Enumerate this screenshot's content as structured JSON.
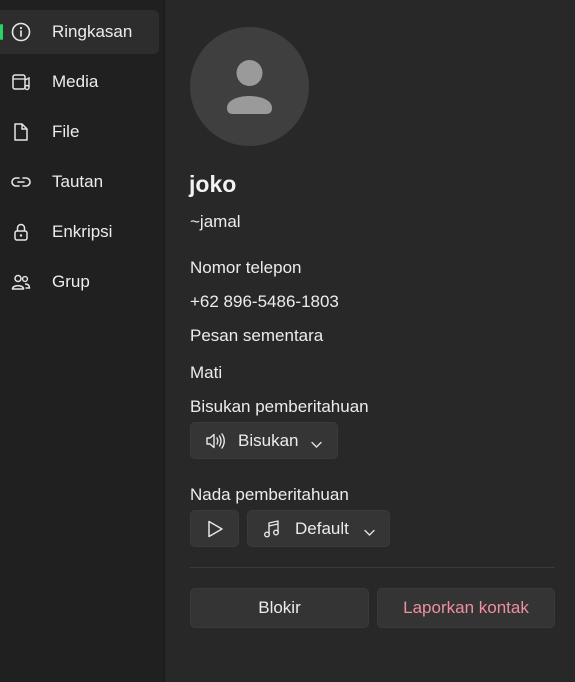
{
  "sidebar": {
    "items": [
      {
        "label": "Ringkasan",
        "icon": "info-icon"
      },
      {
        "label": "Media",
        "icon": "media-icon"
      },
      {
        "label": "File",
        "icon": "file-icon"
      },
      {
        "label": "Tautan",
        "icon": "link-icon"
      },
      {
        "label": "Enkripsi",
        "icon": "lock-icon"
      },
      {
        "label": "Grup",
        "icon": "group-icon"
      }
    ],
    "active_index": 0
  },
  "profile": {
    "name": "joko",
    "username": "~jamal",
    "phone_label": "Nomor telepon",
    "phone_value": "+62 896-5486-1803",
    "temp_msg_label": "Pesan sementara",
    "temp_msg_value": "Mati",
    "mute_label": "Bisukan pemberitahuan",
    "mute_button": "Bisukan",
    "tone_label": "Nada pemberitahuan",
    "tone_value": "Default"
  },
  "actions": {
    "block": "Blokir",
    "report": "Laporkan kontak"
  },
  "colors": {
    "accent": "#25d366",
    "danger_text": "#f08fa0",
    "background": "#282828",
    "sidebar": "#202020"
  }
}
